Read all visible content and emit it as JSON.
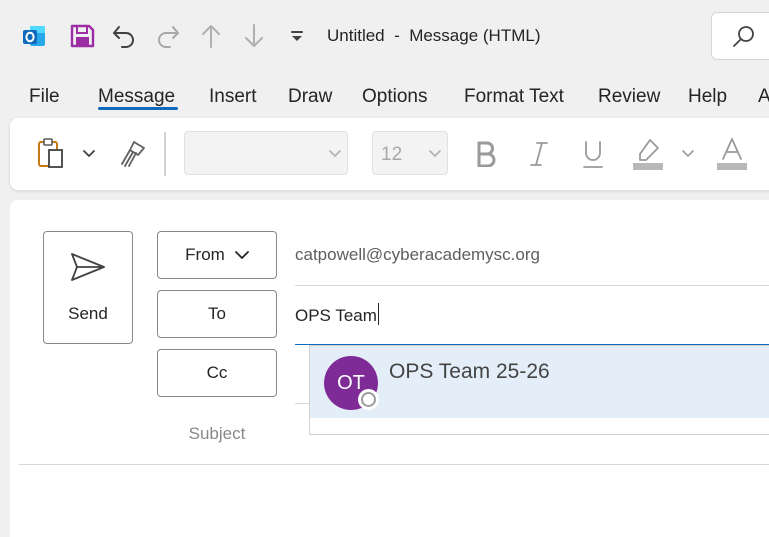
{
  "titlebar": {
    "title": "Untitled  -  Message (HTML)",
    "icons": [
      "outlook-icon",
      "save-icon",
      "undo-icon",
      "redo-icon",
      "up-arrow-icon",
      "down-arrow-icon",
      "customize-quick-access-icon",
      "search-icon"
    ],
    "colors": {
      "outlook_blue": "#0f6cbd",
      "save_purple": "#9c2da5"
    }
  },
  "menu": {
    "tabs": [
      "File",
      "Message",
      "Insert",
      "Draw",
      "Options",
      "Format Text",
      "Review",
      "Help",
      "A"
    ],
    "active": "Message",
    "accent": "#0f6cbd"
  },
  "ribbon": {
    "font_name": "",
    "font_size": "12",
    "icons": [
      "paste-icon",
      "paste-dropdown-icon",
      "format-painter-icon",
      "bold-icon",
      "italic-icon",
      "underline-icon",
      "highlight-icon",
      "font-color-icon"
    ]
  },
  "compose": {
    "send_label": "Send",
    "from_label": "From",
    "from_value": "catpowell@cyberacademysc.org",
    "to_label": "To",
    "to_value": "OPS Team",
    "cc_label": "Cc",
    "subject_label": "Subject"
  },
  "autocomplete": {
    "initials": "OT",
    "name": "OPS Team 25-26",
    "avatar_color": "#7e2b97"
  }
}
